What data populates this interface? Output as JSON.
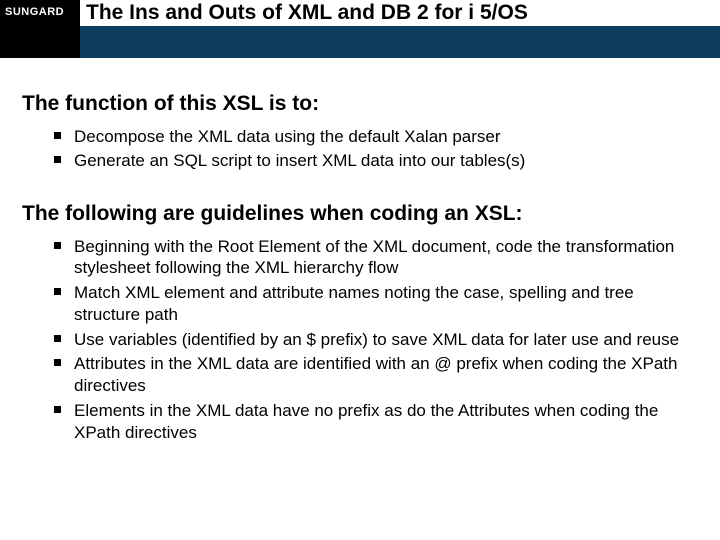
{
  "header": {
    "logo": "SUNGARD",
    "title": "The Ins and Outs of XML and DB 2 for i 5/OS"
  },
  "section1": {
    "heading": "The function of this XSL is to:",
    "items": [
      "Decompose the XML data using the default Xalan parser",
      "Generate an SQL script to insert XML data into our tables(s)"
    ]
  },
  "section2": {
    "heading": "The following are guidelines when coding an XSL:",
    "items": [
      "Beginning with the Root Element of the XML document, code the transformation stylesheet following the XML hierarchy flow",
      "Match XML element and attribute names noting the case, spelling and tree structure path",
      "Use variables (identified by an $ prefix) to save XML data for later use and reuse",
      "Attributes in the XML data are identified with an @ prefix when coding the XPath directives",
      "Elements in the XML data have no prefix as do the Attributes when coding the XPath directives"
    ]
  }
}
